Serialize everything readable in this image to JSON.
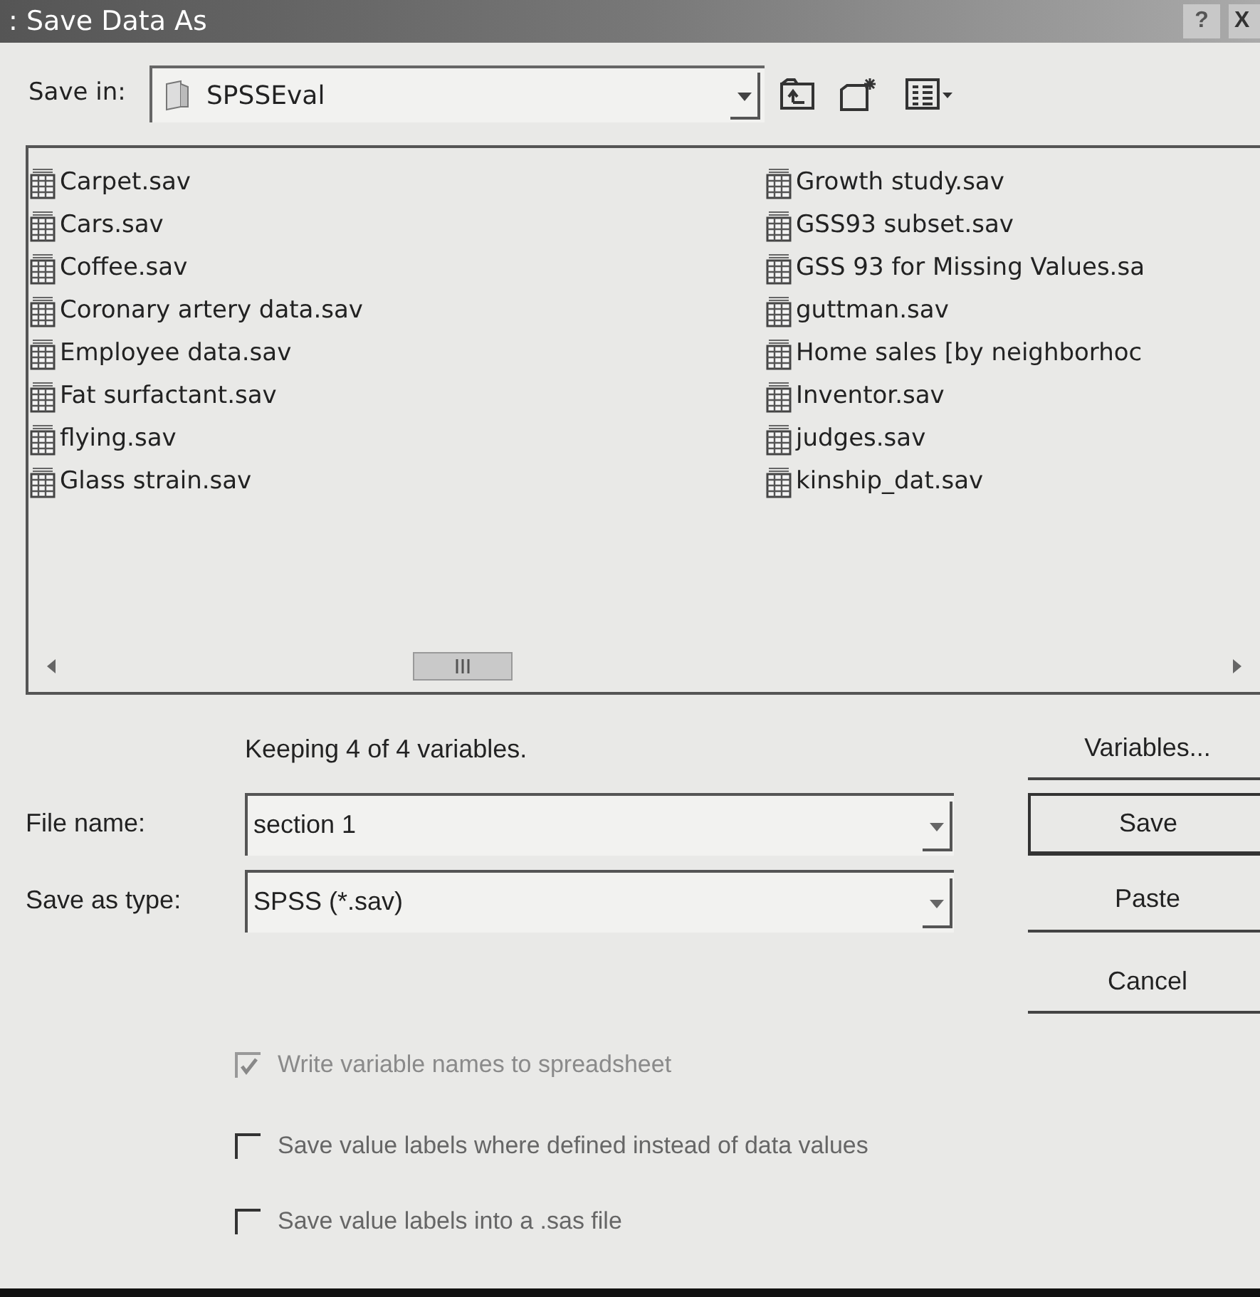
{
  "window": {
    "title": ": Save Data As",
    "help_button": "?",
    "close_button": "X"
  },
  "save_in": {
    "label": "Save in:",
    "value": "SPSSEval"
  },
  "file_columns": [
    [
      {
        "name": "Carpet.sav"
      },
      {
        "name": "Cars.sav"
      },
      {
        "name": "Coffee.sav"
      },
      {
        "name": "Coronary artery data.sav"
      },
      {
        "name": "Employee data.sav"
      },
      {
        "name": "Fat surfactant.sav"
      },
      {
        "name": "flying.sav"
      },
      {
        "name": "Glass strain.sav"
      }
    ],
    [
      {
        "name": "Growth study.sav"
      },
      {
        "name": "GSS93 subset.sav"
      },
      {
        "name": "GSS 93 for Missing Values.sa"
      },
      {
        "name": "guttman.sav"
      },
      {
        "name": "Home sales [by neighborhoc"
      },
      {
        "name": "Inventor.sav"
      },
      {
        "name": "judges.sav"
      },
      {
        "name": "kinship_dat.sav"
      }
    ]
  ],
  "status": "Keeping 4 of 4 variables.",
  "file_name": {
    "label": "File name:",
    "value": "section 1"
  },
  "save_as_type": {
    "label": "Save as type:",
    "value": "SPSS (*.sav)"
  },
  "buttons": [
    {
      "label": "Variables...",
      "default": false
    },
    {
      "label": "Save",
      "default": true
    },
    {
      "label": "Paste",
      "default": false
    },
    {
      "label": "Cancel",
      "default": false
    }
  ],
  "options": [
    {
      "label": "Write variable names to spreadsheet",
      "checked": true,
      "disabled": true
    },
    {
      "label": "Save value labels where defined instead of data values",
      "checked": false,
      "disabled": false
    },
    {
      "label": "Save value labels into a .sas file",
      "checked": false,
      "disabled": false
    }
  ]
}
